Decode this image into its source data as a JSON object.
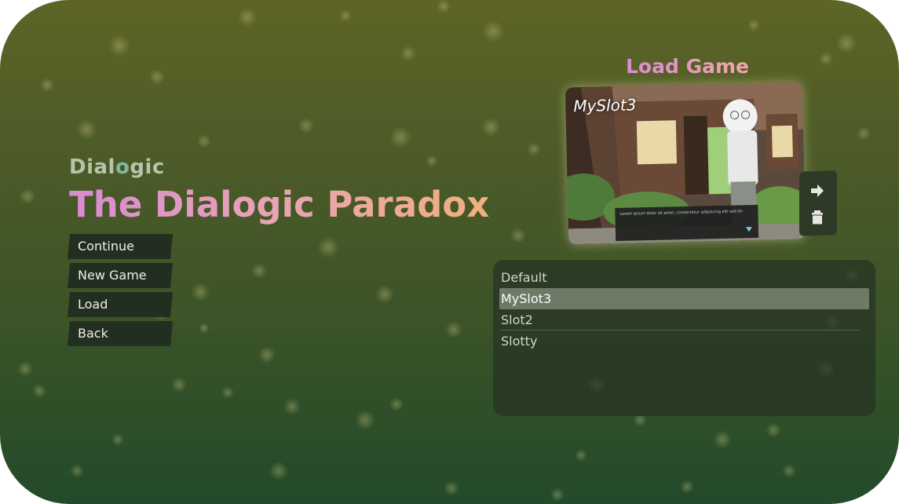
{
  "brand": {
    "logo_text_a": "Dial",
    "logo_text_b": "o",
    "logo_text_c": "gic"
  },
  "title": "The Dialogic Paradox",
  "main_menu": {
    "items": [
      {
        "label": "Continue"
      },
      {
        "label": "New Game"
      },
      {
        "label": "Load"
      },
      {
        "label": "Back"
      }
    ]
  },
  "load_panel": {
    "heading": "Load Game",
    "preview": {
      "slot_label": "MySlot3",
      "dialog_text": "Lorem ipsum dolor sit amet, consectetur adipiscing elit sed do"
    },
    "actions": [
      {
        "icon": "arrow-right-icon"
      },
      {
        "icon": "trash-icon"
      }
    ],
    "slots": [
      {
        "label": "Default",
        "selected": false
      },
      {
        "label": "MySlot3",
        "selected": true
      },
      {
        "label": "Slot2",
        "selected": false
      },
      {
        "label": "Slotty",
        "selected": false
      }
    ]
  },
  "colors": {
    "title_gradient_start": "#d98ad2",
    "title_gradient_end": "#f1b07c",
    "button_bg": "#222e1f",
    "selected_slot": "#6e7a65"
  }
}
